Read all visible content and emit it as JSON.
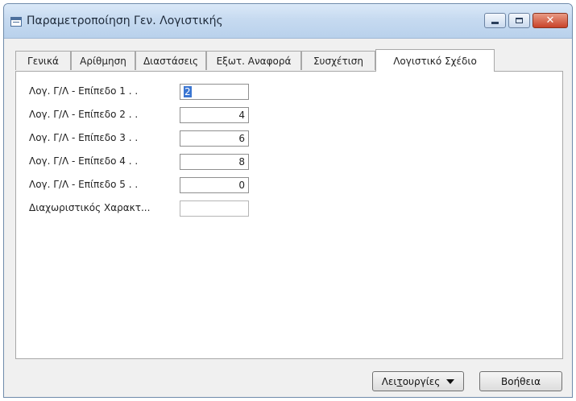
{
  "window": {
    "title": "Παραμετροποίηση Γεν. Λογιστικής",
    "controls": {
      "minimize": "minimize-icon",
      "maximize": "maximize-icon",
      "close": "close-icon"
    }
  },
  "tabs": [
    {
      "label": "Γενικά",
      "active": false
    },
    {
      "label": "Αρίθμηση",
      "active": false
    },
    {
      "label": "Διαστάσεις",
      "active": false
    },
    {
      "label": "Εξωτ. Αναφορά",
      "active": false
    },
    {
      "label": "Συσχέτιση",
      "active": false
    },
    {
      "label": "Λογιστικό Σχέδιο",
      "active": true
    }
  ],
  "fields": [
    {
      "label": "Λογ. Γ/Λ - Επίπεδο 1 . .",
      "value": "2"
    },
    {
      "label": "Λογ. Γ/Λ - Επίπεδο 2 . .",
      "value": "4"
    },
    {
      "label": "Λογ. Γ/Λ - Επίπεδο 3 . .",
      "value": "6"
    },
    {
      "label": "Λογ. Γ/Λ - Επίπεδο 4 . .",
      "value": "8"
    },
    {
      "label": "Λογ. Γ/Λ - Επίπεδο 5 . .",
      "value": "0"
    },
    {
      "label": "Διαχωριστικός Χαρακτ...",
      "value": ""
    }
  ],
  "buttons": {
    "functions_pre": "Λει",
    "functions_mnemonic": "τ",
    "functions_post": "ουργίες",
    "help": "Βοήθεια"
  },
  "colors": {
    "titlebar": "#c6daf0",
    "selection": "#3b76d2",
    "close": "#c8432a"
  }
}
